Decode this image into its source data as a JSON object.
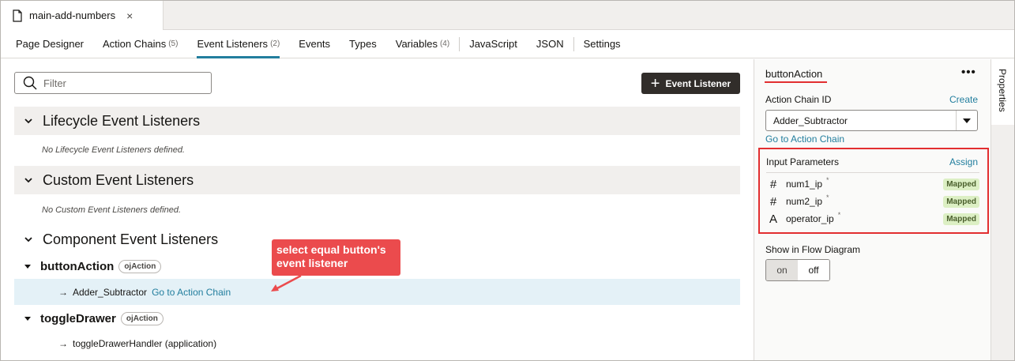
{
  "file_tab": {
    "name": "main-add-numbers",
    "close": "×"
  },
  "tabs": [
    {
      "label": "Page Designer",
      "count": ""
    },
    {
      "label": "Action Chains",
      "count": "(5)"
    },
    {
      "label": "Event Listeners",
      "count": "(2)",
      "active": true
    },
    {
      "label": "Events",
      "count": ""
    },
    {
      "label": "Types",
      "count": ""
    },
    {
      "label": "Variables",
      "count": "(4)"
    },
    {
      "label": "JavaScript",
      "count": ""
    },
    {
      "label": "JSON",
      "count": ""
    },
    {
      "label": "Settings",
      "count": ""
    }
  ],
  "main": {
    "filter_placeholder": "Filter",
    "add_button": "Event Listener",
    "lifecycle": {
      "title": "Lifecycle Event Listeners",
      "empty": "No Lifecycle Event Listeners defined."
    },
    "custom": {
      "title": "Custom Event Listeners",
      "empty": "No Custom Event Listeners defined."
    },
    "component": {
      "title": "Component Event Listeners",
      "listeners": [
        {
          "name": "buttonAction",
          "badge": "ojAction",
          "chain": "Adder_Subtractor",
          "link": "Go to Action Chain"
        },
        {
          "name": "toggleDrawer",
          "badge": "ojAction",
          "chain": "toggleDrawerHandler (application)",
          "link": ""
        }
      ]
    },
    "callout": "select equal button's event listener"
  },
  "panel": {
    "title": "buttonAction",
    "menu": "•••",
    "chain_id_label": "Action Chain ID",
    "create": "Create",
    "chain_value": "Adder_Subtractor",
    "goto": "Go to Action Chain",
    "input_params_label": "Input Parameters",
    "assign": "Assign",
    "params": [
      {
        "type_icon": "#",
        "name": "num1_ip",
        "required": "*",
        "status": "Mapped"
      },
      {
        "type_icon": "#",
        "name": "num2_ip",
        "required": "*",
        "status": "Mapped"
      },
      {
        "type_icon": "A",
        "name": "operator_ip",
        "required": "*",
        "status": "Mapped"
      }
    ],
    "flow_label": "Show in Flow Diagram",
    "toggle_on": "on",
    "toggle_off": "off"
  },
  "side_tab": "Properties",
  "colors": {
    "accent": "#227e9e",
    "highlight": "#e22e30",
    "callout": "#eb4b4d",
    "selected_row": "#e4f1f7"
  }
}
